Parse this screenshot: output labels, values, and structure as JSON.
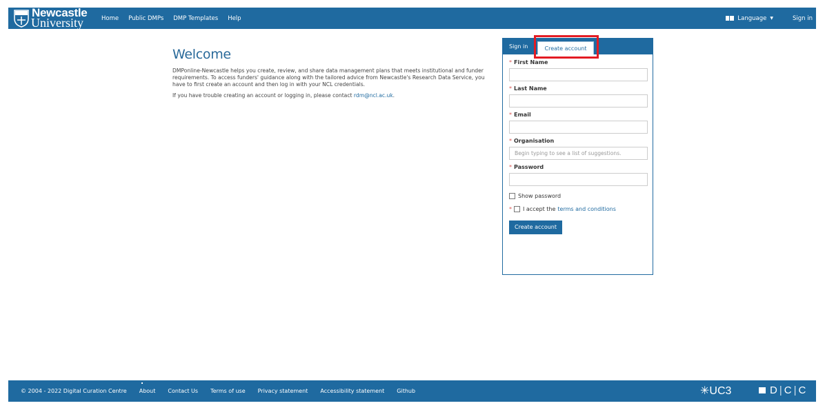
{
  "header": {
    "logo_line1": "Newcastle",
    "logo_line2": "University",
    "nav": [
      "Home",
      "Public DMPs",
      "DMP Templates",
      "Help"
    ],
    "language_label": "Language",
    "signin_label": "Sign in"
  },
  "welcome": {
    "title": "Welcome",
    "paragraph1": "DMPonline-Newcastle helps you create, review, and share data management plans that meets institutional and funder requirements. To access funders' guidance along with the tailored advice from Newcastle's Research Data Service, you have to first create an account and then log in with your NCL credentials.",
    "paragraph2_prefix": "If you have trouble creating an account or logging in, please contact ",
    "contact_email": "rdm@ncl.ac.uk",
    "paragraph2_suffix": "."
  },
  "panel": {
    "tab_signin": "Sign in",
    "tab_create": "Create account",
    "required_marker": "*",
    "fields": {
      "first_name": {
        "label": "First Name",
        "value": "",
        "placeholder": ""
      },
      "last_name": {
        "label": "Last Name",
        "value": "",
        "placeholder": ""
      },
      "email": {
        "label": "Email",
        "value": "",
        "placeholder": ""
      },
      "organisation": {
        "label": "Organisation",
        "value": "",
        "placeholder": "Begin typing to see a list of suggestions."
      },
      "password": {
        "label": "Password",
        "value": "",
        "placeholder": ""
      }
    },
    "show_password_label": "Show password",
    "show_password_checked": false,
    "accept_prefix": "I accept the",
    "accept_link": "terms and conditions",
    "accept_checked": false,
    "submit_label": "Create account"
  },
  "highlight_color": "#e31b23",
  "brand_color": "#1f6aa0",
  "footer": {
    "copyright": "© 2004 - 2022 Digital Curation Centre",
    "links": [
      "About",
      "Contact Us",
      "Terms of use",
      "Privacy statement",
      "Accessibility statement",
      "Github"
    ],
    "uc3_logo": "UC3",
    "dcc_logo": [
      "D",
      "C",
      "C"
    ]
  }
}
